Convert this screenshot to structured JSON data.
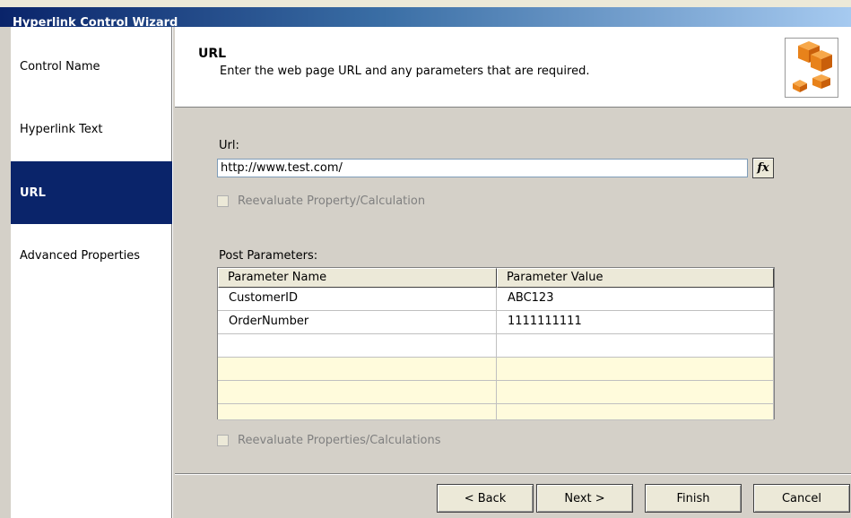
{
  "window": {
    "title": "Hyperlink Control Wizard"
  },
  "sidebar": {
    "items": [
      {
        "label": "Control Name"
      },
      {
        "label": "Hyperlink Text"
      },
      {
        "label": "URL",
        "active": true
      },
      {
        "label": "Advanced Properties"
      }
    ]
  },
  "header": {
    "title": "URL",
    "subtitle": "Enter the web page URL and any parameters that are required.",
    "icon": "orange-cubes-icon"
  },
  "form": {
    "url_label": "Url:",
    "url_value": "http://www.test.com/",
    "fx_label": "fx",
    "reevaluate_url_label": "Reevaluate Property/Calculation",
    "post_params_label": "Post Parameters:",
    "columns": [
      "Parameter Name",
      "Parameter Value"
    ],
    "rows": [
      [
        "CustomerID",
        "ABC123"
      ],
      [
        "OrderNumber",
        "1111111111"
      ]
    ],
    "reevaluate_params_label": "Reevaluate Properties/Calculations"
  },
  "buttons": {
    "back": "< Back",
    "next": "Next >",
    "finish": "Finish",
    "cancel": "Cancel"
  },
  "colors": {
    "active_item": "#0a246a",
    "empty_row": "#fffbdc",
    "accent_orange": "#e8821a"
  }
}
